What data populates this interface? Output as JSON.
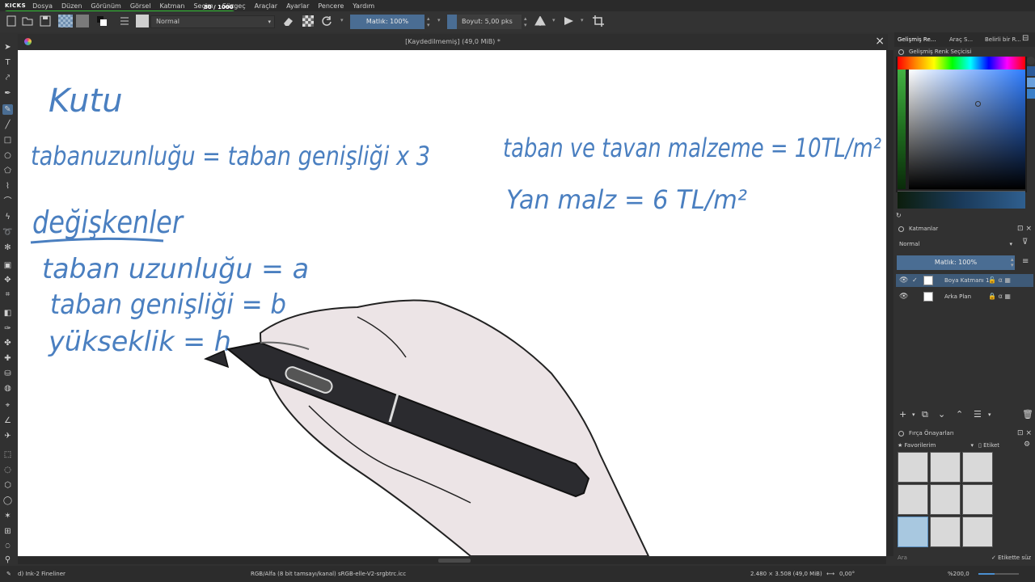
{
  "app": {
    "logo": "KICKS",
    "progress_label": "80 / 1000",
    "progress_value": 0.08
  },
  "menu": [
    "Dosya",
    "Düzen",
    "Görünüm",
    "Görsel",
    "Katman",
    "Seçim",
    "Süzgeç",
    "Araçlar",
    "Ayarlar",
    "Pencere",
    "Yardım"
  ],
  "tool_options": {
    "blend_mode": "Normal",
    "opacity": "Matlık: 100%",
    "size": "Boyut: 5,00 pks"
  },
  "document": {
    "title": "[Kaydedilmemiş]  (49,0 MiB) *"
  },
  "canvas_text": {
    "line1": "Kutu",
    "line2": "tabanuzunluğu = taban genişliği x 3",
    "line3": "taban ve tavan malzeme = 10TL/m²",
    "line4": "Yan malz = 6 TL/m²",
    "line5": "değişkenler",
    "line6": "taban uzunluğu = a",
    "line7": "taban genişliği = b",
    "line8": "yükseklik = h"
  },
  "docker": {
    "tabs": [
      "Gelişmiş Re...",
      "Araç S...",
      "Belirli bir R..."
    ],
    "color_selector_title": "Gelişmiş Renk Seçicisi",
    "layers_title": "Katmanlar",
    "layer_blend": "Normal",
    "layer_opacity": "Matlık:  100%",
    "layers": [
      {
        "name": "Boya Katmanı 1",
        "selected": true
      },
      {
        "name": "Arka Plan",
        "selected": false
      }
    ],
    "brush_title": "Fırça Önayarları",
    "brush_filter": "★ Favorilerim",
    "brush_tag": "Etiket",
    "brush_search_placeholder": "Ara",
    "brush_tag_search": "Etikette süz"
  },
  "status": {
    "brush": "d) Ink-2 Fineliner",
    "color_space": "RGB/Alfa (8 bit tamsayı/kanal)  sRGB-elle-V2-srgbtrc.icc",
    "dimensions": "2.480 × 3.508 (49,0 MiB)",
    "rotation": "0,00°",
    "zoom": "%200,0"
  },
  "colors": {
    "accent": "#4a6d93",
    "ink": "#4a7fc0"
  }
}
